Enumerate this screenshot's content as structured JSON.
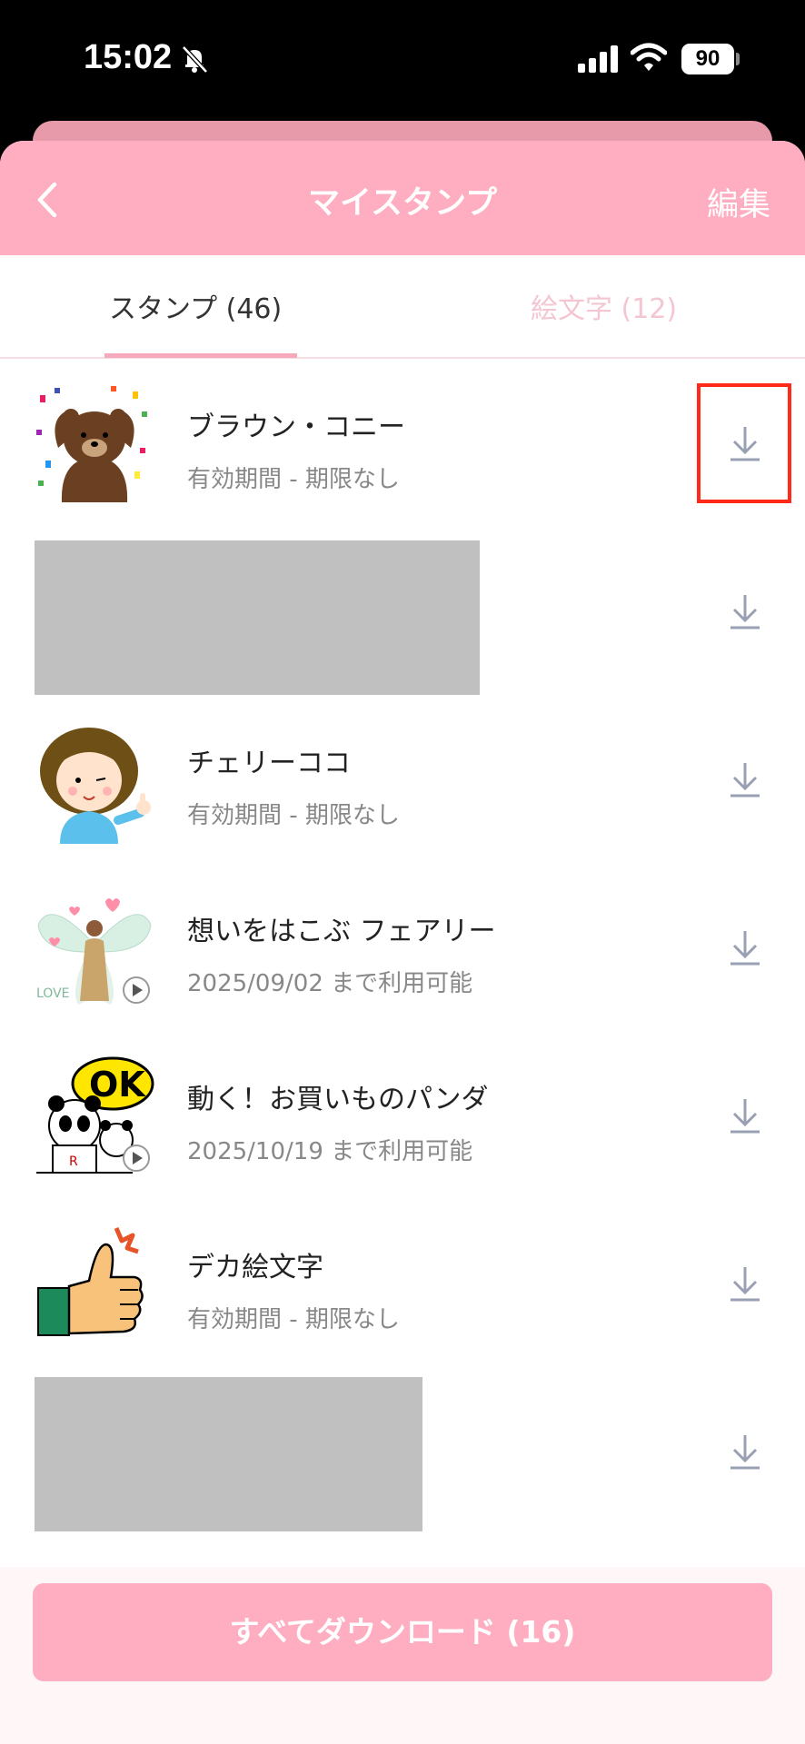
{
  "status_bar": {
    "time": "15:02",
    "battery": "90"
  },
  "header": {
    "title": "マイスタンプ",
    "edit_label": "編集"
  },
  "tabs": [
    {
      "label": "スタンプ (46)",
      "active": true
    },
    {
      "label": "絵文字 (12)",
      "active": false
    }
  ],
  "items": [
    {
      "title": "ブラウン・コニー",
      "subtitle": "有効期間 - 期限なし",
      "thumb": "brown-bear-sticker"
    },
    {
      "title": "",
      "subtitle": "",
      "thumb": "redacted"
    },
    {
      "title": "チェリーココ",
      "subtitle": "有効期間 - 期限なし",
      "thumb": "cherry-coco-sticker"
    },
    {
      "title": "想いをはこぶ フェアリー",
      "subtitle": "2025/09/02 まで利用可能",
      "thumb": "fairy-sticker"
    },
    {
      "title": "動く！お買いものパンダ",
      "subtitle": "2025/10/19 まで利用可能",
      "thumb": "panda-sticker"
    },
    {
      "title": "デカ絵文字",
      "subtitle": "有効期間 - 期限なし",
      "thumb": "thumbs-up-sticker"
    },
    {
      "title": "",
      "subtitle": "",
      "thumb": "redacted"
    }
  ],
  "footer": {
    "download_all_label": "すべてダウンロード (16)"
  },
  "colors": {
    "accent": "#ffadc1",
    "highlight": "#ff2a1a"
  }
}
